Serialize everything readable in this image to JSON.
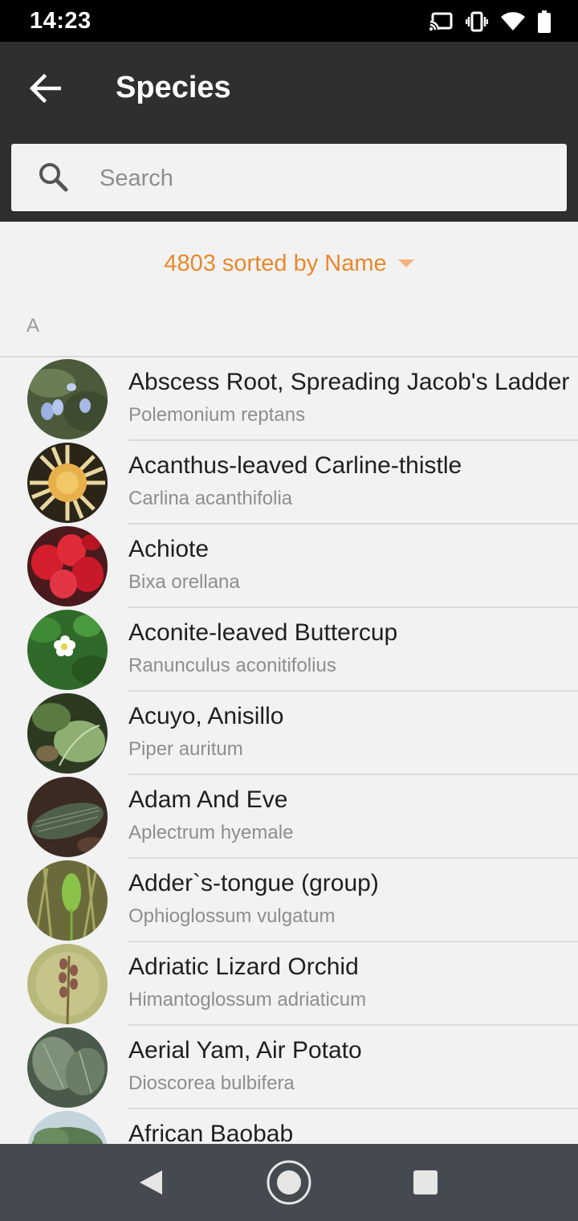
{
  "status_bar": {
    "time": "14:23",
    "icons": [
      "cast-icon",
      "vibrate-icon",
      "wifi-icon",
      "battery-icon"
    ]
  },
  "app_bar": {
    "back_icon": "arrow-back-icon",
    "title": "Species",
    "background": "#2f2f2f"
  },
  "search": {
    "placeholder": "Search",
    "value": "",
    "icon": "search-icon"
  },
  "sort": {
    "label": "4803 sorted by Name",
    "dropdown_icon": "triangle-down-icon",
    "accent_color": "#e8892d"
  },
  "section": {
    "header": "A"
  },
  "species": [
    {
      "common": "Abscess Root, Spreading Jacob's Ladder",
      "scientific": "Polemonium reptans"
    },
    {
      "common": "Acanthus-leaved Carline-thistle",
      "scientific": "Carlina acanthifolia"
    },
    {
      "common": "Achiote",
      "scientific": "Bixa orellana"
    },
    {
      "common": "Aconite-leaved Buttercup",
      "scientific": "Ranunculus aconitifolius"
    },
    {
      "common": "Acuyo, Anisillo",
      "scientific": "Piper auritum"
    },
    {
      "common": "Adam And Eve",
      "scientific": "Aplectrum hyemale"
    },
    {
      "common": "Adder`s-tongue (group)",
      "scientific": "Ophioglossum vulgatum"
    },
    {
      "common": "Adriatic Lizard Orchid",
      "scientific": "Himantoglossum adriaticum"
    },
    {
      "common": "Aerial Yam, Air Potato",
      "scientific": "Dioscorea bulbifera"
    },
    {
      "common": "African Baobab",
      "scientific": ""
    }
  ],
  "nav_bar": {
    "icons": [
      "nav-back-icon",
      "nav-home-icon",
      "nav-recents-icon"
    ]
  }
}
